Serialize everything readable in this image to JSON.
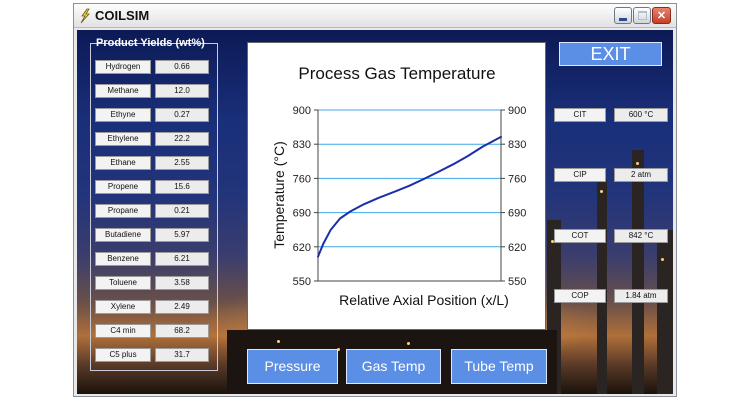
{
  "window": {
    "title": "COILSIM",
    "controls": {
      "minimize": "minimize",
      "maximize": "maximize",
      "close": "✕"
    }
  },
  "yields": {
    "title": "Product Yields (wt%)",
    "rows": [
      {
        "label": "Hydrogen",
        "value": "0.66"
      },
      {
        "label": "Methane",
        "value": "12.0"
      },
      {
        "label": "Ethyne",
        "value": "0.27"
      },
      {
        "label": "Ethylene",
        "value": "22.2"
      },
      {
        "label": "Ethane",
        "value": "2.55"
      },
      {
        "label": "Propene",
        "value": "15.6"
      },
      {
        "label": "Propane",
        "value": "0.21"
      },
      {
        "label": "Butadiene",
        "value": "5.97"
      },
      {
        "label": "Benzene",
        "value": "6.21"
      },
      {
        "label": "Toluene",
        "value": "3.58"
      },
      {
        "label": "Xylene",
        "value": "2.49"
      },
      {
        "label": "C4 min",
        "value": "68.2"
      },
      {
        "label": "C5 plus",
        "value": "31.7"
      }
    ]
  },
  "params": [
    {
      "label": "CIT",
      "value": "600 °C"
    },
    {
      "label": "CIP",
      "value": "2 atm"
    },
    {
      "label": "COT",
      "value": "842 °C"
    },
    {
      "label": "COP",
      "value": "1.84 atm"
    }
  ],
  "buttons": {
    "exit": "EXIT",
    "pressure": "Pressure",
    "gas_temp": "Gas Temp",
    "tube_temp": "Tube Temp"
  },
  "colors": {
    "accent_button": "#5b8fe6",
    "curve": "#1a2fa8",
    "gridline": "#3ea8e6"
  },
  "chart_data": {
    "type": "line",
    "title": "Process Gas Temperature",
    "xlabel": "Relative Axial Position (x/L)",
    "ylabel": "Temperature (°C)",
    "xlim": [
      0,
      1
    ],
    "ylim": [
      550,
      900
    ],
    "yticks": [
      "550",
      "620",
      "690",
      "760",
      "830",
      "900"
    ],
    "y2ticks": [
      "550",
      "620",
      "690",
      "760",
      "830",
      "900"
    ],
    "grid": "horizontal",
    "series": [
      {
        "x": [
          0.0,
          0.03,
          0.07,
          0.12,
          0.18,
          0.25,
          0.33,
          0.42,
          0.5,
          0.58,
          0.66,
          0.74,
          0.82,
          0.9,
          1.0
        ],
        "values": [
          600,
          627,
          655,
          678,
          693,
          707,
          720,
          733,
          745,
          759,
          774,
          789,
          806,
          825,
          845
        ]
      }
    ]
  }
}
